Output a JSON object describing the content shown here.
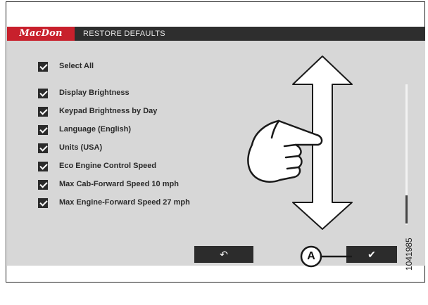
{
  "header": {
    "brand": "MacDon",
    "title": "RESTORE DEFAULTS"
  },
  "options": [
    {
      "label": "Select All",
      "checked": true
    },
    {
      "label": "Display Brightness",
      "checked": true
    },
    {
      "label": "Keypad Brightness by Day",
      "checked": true
    },
    {
      "label": "Language (English)",
      "checked": true
    },
    {
      "label": "Units (USA)",
      "checked": true
    },
    {
      "label": "Eco Engine Control Speed",
      "checked": true
    },
    {
      "label": "Max Cab-Forward Speed 10 mph",
      "checked": true
    },
    {
      "label": "Max Engine-Forward Speed 27 mph",
      "checked": true
    }
  ],
  "buttons": {
    "back_icon": "back-arrow-icon",
    "confirm_icon": "checkmark-icon",
    "back_glyph": "↶",
    "confirm_glyph": "✔"
  },
  "annotations": {
    "callout": "A",
    "figure_number": "1041985",
    "gesture": "hand-swipe-icon"
  },
  "colors": {
    "brand_red": "#c8202c",
    "title_bar": "#2e2e2e",
    "screen_bg": "#d7d7d7"
  }
}
